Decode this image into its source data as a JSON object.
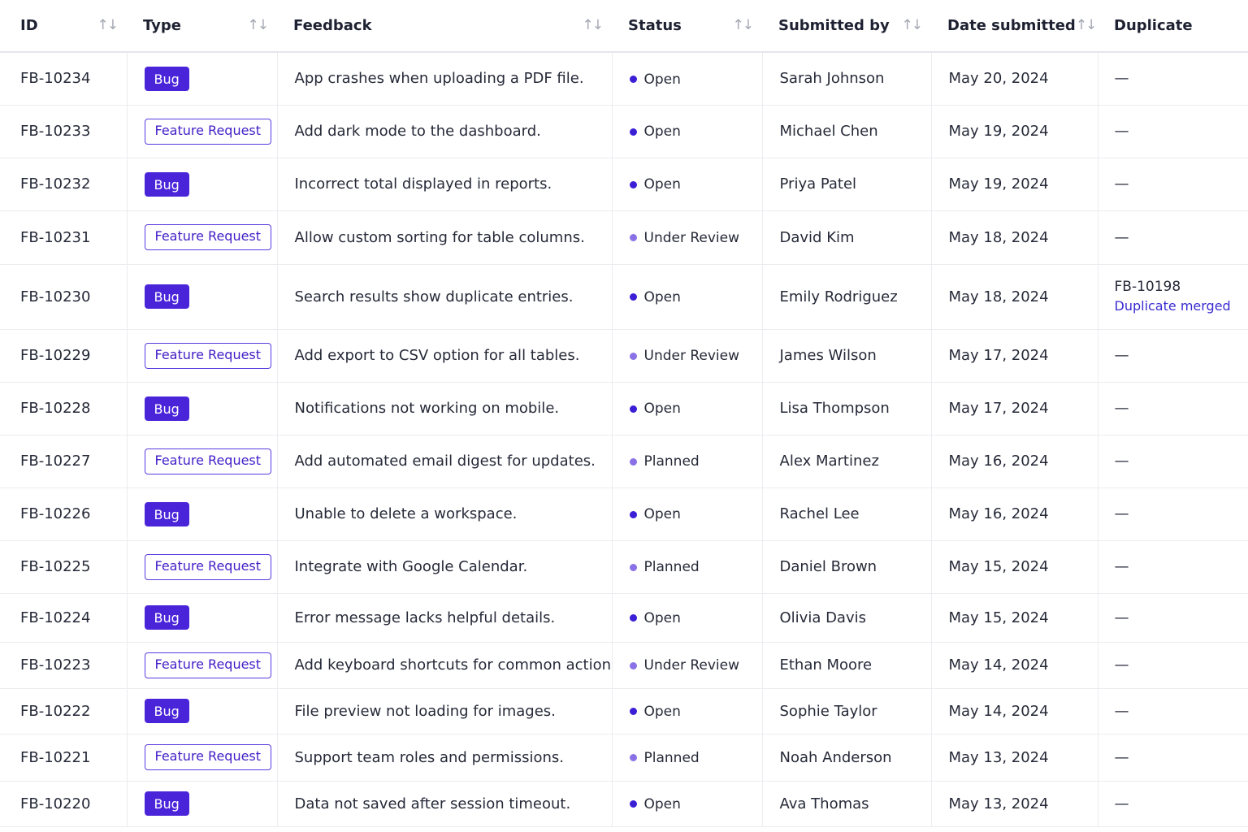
{
  "columns": [
    {
      "label": "ID",
      "sortable": true
    },
    {
      "label": "Type",
      "sortable": true
    },
    {
      "label": "Feedback",
      "sortable": true
    },
    {
      "label": "Status",
      "sortable": true
    },
    {
      "label": "Submitted by",
      "sortable": true
    },
    {
      "label": "Date submitted",
      "sortable": true
    },
    {
      "label": "Duplicate",
      "sortable": false
    }
  ],
  "sort_icon": "↑↓",
  "colors": {
    "accent": "#4a24d9",
    "status_open": "#3b1fd6",
    "status_soft": "#8a72e6"
  },
  "rows": [
    {
      "id": "FB-10234",
      "type": "Bug",
      "feedback": "App crashes when uploading a PDF file.",
      "status": "Open",
      "submitted_by": "Sarah Johnson",
      "date": "May 20, 2024",
      "duplicate": "—"
    },
    {
      "id": "FB-10233",
      "type": "Feature Request",
      "feedback": "Add dark mode to the dashboard.",
      "status": "Open",
      "submitted_by": "Michael Chen",
      "date": "May 19, 2024",
      "duplicate": "—"
    },
    {
      "id": "FB-10232",
      "type": "Bug",
      "feedback": "Incorrect total displayed in reports.",
      "status": "Open",
      "submitted_by": "Priya Patel",
      "date": "May 19, 2024",
      "duplicate": "—"
    },
    {
      "id": "FB-10231",
      "type": "Feature Request",
      "feedback": "Allow custom sorting for table columns.",
      "status": "Under Review",
      "submitted_by": "David Kim",
      "date": "May 18, 2024",
      "duplicate": "—"
    },
    {
      "id": "FB-10230",
      "type": "Bug",
      "feedback": "Search results show duplicate entries.",
      "status": "Open",
      "submitted_by": "Emily Rodriguez",
      "date": "May 18, 2024",
      "duplicate": "FB-10198",
      "duplicate_note": "Duplicate merged"
    },
    {
      "id": "FB-10229",
      "type": "Feature Request",
      "feedback": "Add export to CSV option for all tables.",
      "status": "Under Review",
      "submitted_by": "James Wilson",
      "date": "May 17, 2024",
      "duplicate": "—"
    },
    {
      "id": "FB-10228",
      "type": "Bug",
      "feedback": "Notifications not working on mobile.",
      "status": "Open",
      "submitted_by": "Lisa Thompson",
      "date": "May 17, 2024",
      "duplicate": "—"
    },
    {
      "id": "FB-10227",
      "type": "Feature Request",
      "feedback": "Add automated email digest for updates.",
      "status": "Planned",
      "submitted_by": "Alex Martinez",
      "date": "May 16, 2024",
      "duplicate": "—"
    },
    {
      "id": "FB-10226",
      "type": "Bug",
      "feedback": "Unable to delete a workspace.",
      "status": "Open",
      "submitted_by": "Rachel Lee",
      "date": "May 16, 2024",
      "duplicate": "—"
    },
    {
      "id": "FB-10225",
      "type": "Feature Request",
      "feedback": "Integrate with Google Calendar.",
      "status": "Planned",
      "submitted_by": "Daniel Brown",
      "date": "May 15, 2024",
      "duplicate": "—"
    },
    {
      "id": "FB-10224",
      "type": "Bug",
      "feedback": "Error message lacks helpful details.",
      "status": "Open",
      "submitted_by": "Olivia Davis",
      "date": "May 15, 2024",
      "duplicate": "—"
    },
    {
      "id": "FB-10223",
      "type": "Feature Request",
      "feedback": "Add keyboard shortcuts for common actions.",
      "status": "Under Review",
      "submitted_by": "Ethan Moore",
      "date": "May 14, 2024",
      "duplicate": "—"
    },
    {
      "id": "FB-10222",
      "type": "Bug",
      "feedback": "File preview not loading for images.",
      "status": "Open",
      "submitted_by": "Sophie Taylor",
      "date": "May 14, 2024",
      "duplicate": "—"
    },
    {
      "id": "FB-10221",
      "type": "Feature Request",
      "feedback": "Support team roles and permissions.",
      "status": "Planned",
      "submitted_by": "Noah Anderson",
      "date": "May 13, 2024",
      "duplicate": "—"
    },
    {
      "id": "FB-10220",
      "type": "Bug",
      "feedback": "Data not saved after session timeout.",
      "status": "Open",
      "submitted_by": "Ava Thomas",
      "date": "May 13, 2024",
      "duplicate": "—"
    }
  ]
}
